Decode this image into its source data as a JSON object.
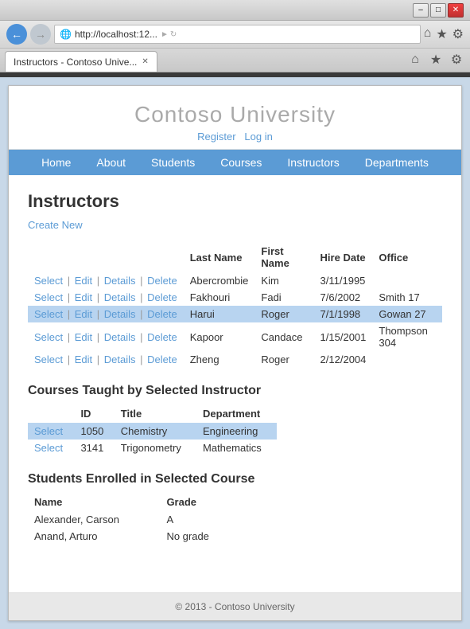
{
  "browser": {
    "title_bar": {
      "minimize": "–",
      "maximize": "□",
      "close": "✕"
    },
    "address": "http://localhost:12...",
    "tab_label": "Instructors - Contoso Unive...",
    "close_tab": "✕"
  },
  "site": {
    "title": "Contoso University",
    "header_links": {
      "register": "Register",
      "login": "Log in"
    },
    "nav": [
      "Home",
      "About",
      "Students",
      "Courses",
      "Instructors",
      "Departments"
    ]
  },
  "page": {
    "title": "Instructors",
    "create_new": "Create New"
  },
  "instructors_table": {
    "headers": [
      "",
      "Last Name",
      "First Name",
      "Hire Date",
      "Office"
    ],
    "rows": [
      {
        "actions": [
          "Select",
          "Edit",
          "Details",
          "Delete"
        ],
        "last_name": "Abercrombie",
        "first_name": "Kim",
        "hire_date": "3/11/1995",
        "office": "",
        "selected": false
      },
      {
        "actions": [
          "Select",
          "Edit",
          "Details",
          "Delete"
        ],
        "last_name": "Fakhouri",
        "first_name": "Fadi",
        "hire_date": "7/6/2002",
        "office": "Smith 17",
        "selected": false
      },
      {
        "actions": [
          "Select",
          "Edit",
          "Details",
          "Delete"
        ],
        "last_name": "Harui",
        "first_name": "Roger",
        "hire_date": "7/1/1998",
        "office": "Gowan 27",
        "selected": true
      },
      {
        "actions": [
          "Select",
          "Edit",
          "Details",
          "Delete"
        ],
        "last_name": "Kapoor",
        "first_name": "Candace",
        "hire_date": "1/15/2001",
        "office": "Thompson 304",
        "selected": false
      },
      {
        "actions": [
          "Select",
          "Edit",
          "Details",
          "Delete"
        ],
        "last_name": "Zheng",
        "first_name": "Roger",
        "hire_date": "2/12/2004",
        "office": "",
        "selected": false
      }
    ]
  },
  "courses_section": {
    "title": "Courses Taught by Selected Instructor",
    "headers": [
      "",
      "ID",
      "Title",
      "Department"
    ],
    "rows": [
      {
        "action": "Select",
        "id": "1050",
        "title": "Chemistry",
        "department": "Engineering",
        "selected": true
      },
      {
        "action": "Select",
        "id": "3141",
        "title": "Trigonometry",
        "department": "Mathematics",
        "selected": false
      }
    ]
  },
  "students_section": {
    "title": "Students Enrolled in Selected Course",
    "headers": [
      "Name",
      "Grade"
    ],
    "rows": [
      {
        "name": "Alexander, Carson",
        "grade": "A"
      },
      {
        "name": "Anand, Arturo",
        "grade": "No grade"
      }
    ]
  },
  "footer": {
    "text": "© 2013 - Contoso University"
  }
}
